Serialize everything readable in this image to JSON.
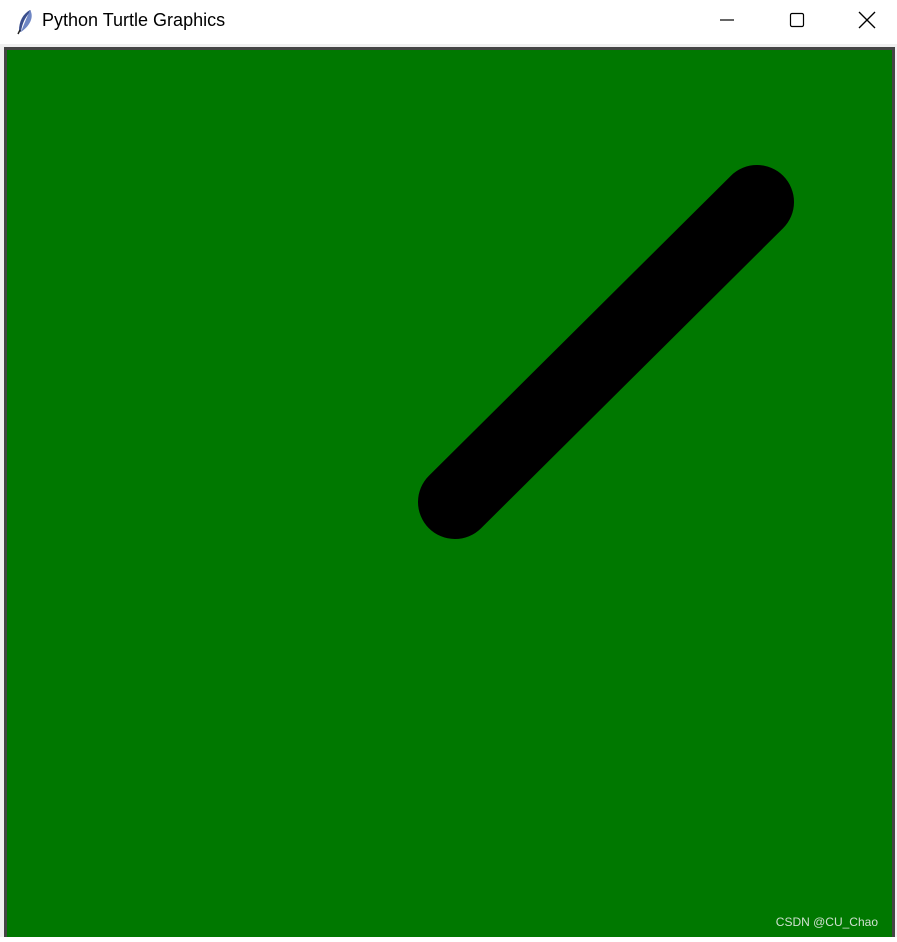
{
  "window": {
    "title": "Python Turtle Graphics",
    "icon": "feather-icon",
    "controls": {
      "minimize_icon": "minimize-icon",
      "maximize_icon": "maximize-icon",
      "close_icon": "close-icon"
    }
  },
  "canvas": {
    "background_color": "#007800",
    "stroke": {
      "color": "#000000",
      "cap": "round"
    }
  },
  "watermark": {
    "text": "CSDN @CU_Chao"
  }
}
